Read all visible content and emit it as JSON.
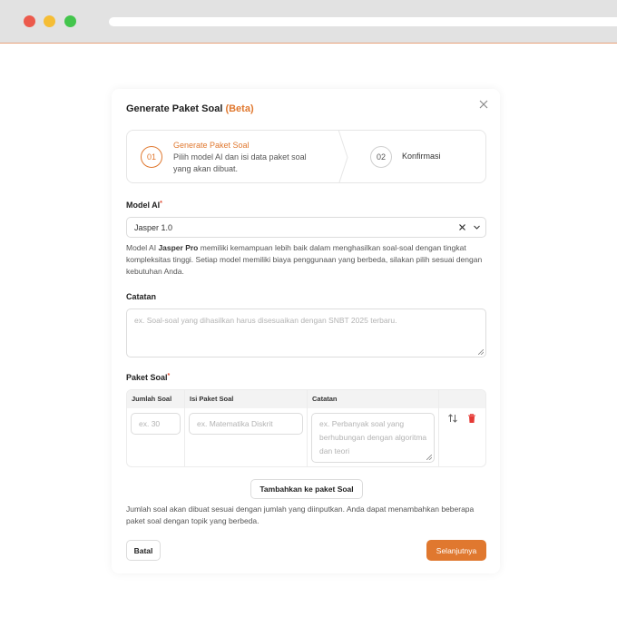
{
  "modal": {
    "title": "Generate Paket Soal",
    "title_badge": "(Beta)"
  },
  "steps": [
    {
      "number": "01",
      "title": "Generate Paket Soal",
      "description": "Pilih model AI dan isi data paket soal yang akan dibuat."
    },
    {
      "number": "02",
      "title": "Konfirmasi"
    }
  ],
  "model_ai": {
    "label": "Model AI",
    "required_mark": "*",
    "value": "Jasper 1.0",
    "help_prefix": "Model AI ",
    "help_bold": "Jasper Pro",
    "help_suffix": " memiliki kemampuan lebih baik dalam menghasilkan soal-soal dengan tingkat kompleksitas tinggi. Setiap model memiliki biaya penggunaan yang berbeda, silakan pilih sesuai dengan kebutuhan Anda."
  },
  "catatan": {
    "label": "Catatan",
    "placeholder": "ex. Soal-soal yang dihasilkan harus disesuaikan dengan SNBT 2025 terbaru."
  },
  "paket_soal": {
    "label": "Paket Soal",
    "required_mark": "*",
    "columns": [
      "Jumlah Soal",
      "Isi Paket Soal",
      "Catatan"
    ],
    "row": {
      "jumlah_placeholder": "ex. 30",
      "isi_placeholder": "ex. Matematika Diskrit",
      "catatan_placeholder": "ex. Perbanyak soal yang berhubungan dengan algoritma dan teori"
    },
    "add_button": "Tambahkan ke paket Soal",
    "help": "Jumlah soal akan dibuat sesuai dengan jumlah yang diinputkan. Anda dapat menambahkan beberapa paket soal dengan topik yang berbeda."
  },
  "footer": {
    "cancel": "Batal",
    "next": "Selanjutnya"
  },
  "colors": {
    "accent": "#e0782f",
    "required": "#e0482f",
    "danger": "#e53935"
  },
  "icons": [
    "close-icon",
    "clear-icon",
    "chevron-down-icon",
    "sort-icon",
    "trash-icon"
  ]
}
